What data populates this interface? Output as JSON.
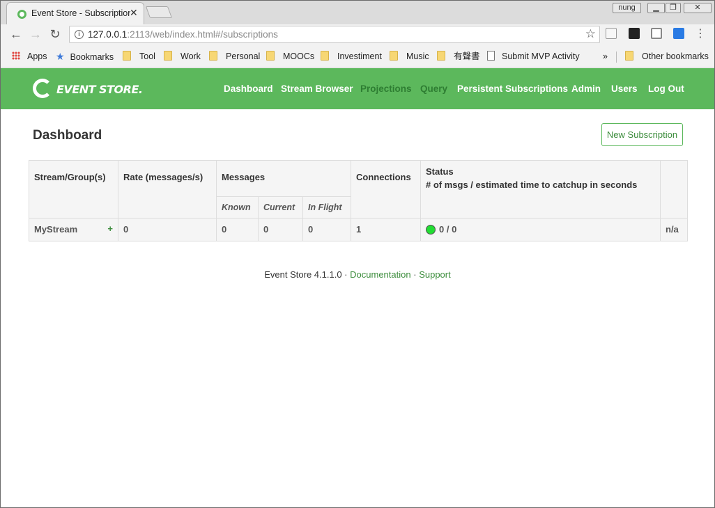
{
  "browser": {
    "tab_title": "Event Store - Subscriptions",
    "tab_close": "✕",
    "profile": "nung",
    "url_host": "127.0.0.1",
    "url_rest": ":2113/web/index.html#/subscriptions",
    "bookmarks": [
      {
        "label": "Apps",
        "icon": "apps-icon"
      },
      {
        "label": "Bookmarks",
        "icon": "star-icon"
      },
      {
        "label": "Tool",
        "icon": "folder-icon"
      },
      {
        "label": "Work",
        "icon": "folder-icon"
      },
      {
        "label": "Personal",
        "icon": "folder-icon"
      },
      {
        "label": "MOOCs",
        "icon": "folder-icon"
      },
      {
        "label": "Investiment",
        "icon": "folder-icon"
      },
      {
        "label": "Music",
        "icon": "folder-icon"
      },
      {
        "label": "有聲書",
        "icon": "folder-icon"
      },
      {
        "label": "Submit MVP Activity",
        "icon": "page-icon"
      },
      {
        "label": "Other bookmarks",
        "icon": "folder-icon"
      }
    ],
    "overflow": "»"
  },
  "app": {
    "logo_text": "EVENT STORE.",
    "nav": [
      "Dashboard",
      "Stream Browser",
      "Projections",
      "Query",
      "Persistent Subscriptions",
      "Admin",
      "Users",
      "Log Out"
    ],
    "accent": "#5cb85c",
    "active_color": "#2e7d32"
  },
  "main": {
    "title": "Dashboard",
    "new_button": "New Subscription",
    "table": {
      "headers": {
        "stream": "Stream/Group(s)",
        "rate": "Rate (messages/s)",
        "messages": "Messages",
        "known": "Known",
        "current": "Current",
        "inflight": "In Flight",
        "connections": "Connections",
        "status": "Status",
        "status_sub": "# of msgs / estimated time to catchup in seconds"
      },
      "rows": [
        {
          "stream": "MyStream",
          "expand": "+",
          "rate": "0",
          "known": "0",
          "current": "0",
          "inflight": "0",
          "connections": "1",
          "status": "0 / 0",
          "status_color": "#22dd33",
          "last": "n/a"
        }
      ]
    }
  },
  "footer": {
    "version": "Event Store 4.1.1.0",
    "sep": "·",
    "documentation": "Documentation",
    "support": "Support"
  }
}
